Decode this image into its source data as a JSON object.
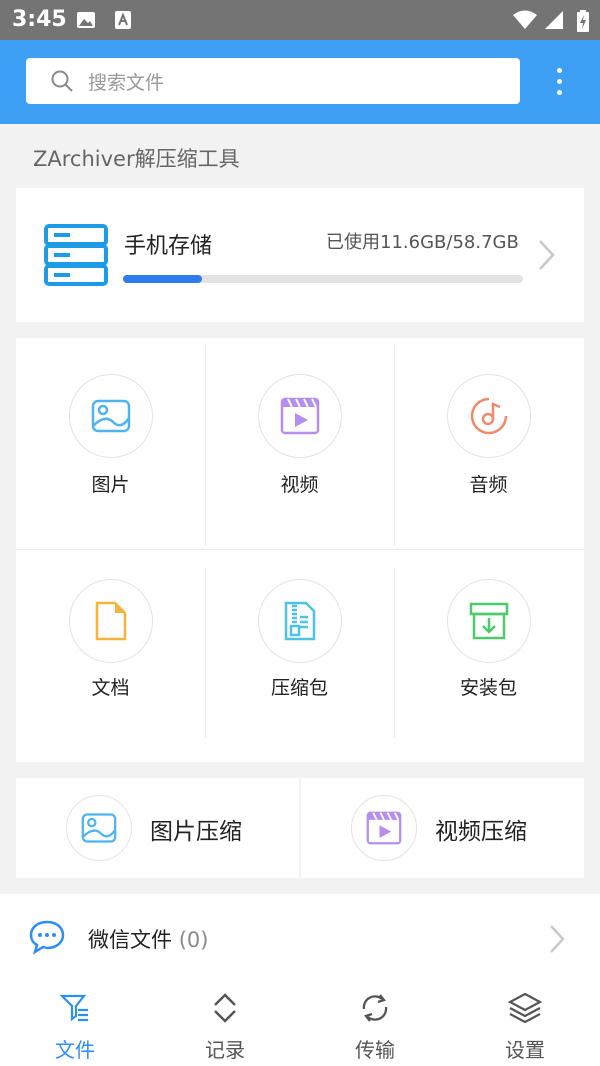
{
  "status_bar": {
    "time": "3:45"
  },
  "search": {
    "placeholder": "搜索文件"
  },
  "section_title": "ZArchiver解压缩工具",
  "storage": {
    "label": "手机存储",
    "used_text": "已使用11.6GB/58.7GB",
    "used_fraction": 0.198
  },
  "categories": [
    {
      "label": "图片",
      "icon": "image-icon"
    },
    {
      "label": "视频",
      "icon": "video-icon"
    },
    {
      "label": "音频",
      "icon": "audio-icon"
    },
    {
      "label": "文档",
      "icon": "document-icon"
    },
    {
      "label": "压缩包",
      "icon": "archive-icon"
    },
    {
      "label": "安装包",
      "icon": "install-package-icon"
    }
  ],
  "compress_tools": [
    {
      "label": "图片压缩",
      "icon": "image-icon"
    },
    {
      "label": "视频压缩",
      "icon": "video-icon"
    }
  ],
  "wechat": {
    "label": "微信文件",
    "count": "(0)"
  },
  "bottom_nav": [
    {
      "label": "文件",
      "icon": "filter-list-icon",
      "active": true
    },
    {
      "label": "记录",
      "icon": "chevron-updown-icon",
      "active": false
    },
    {
      "label": "传输",
      "icon": "sync-icon",
      "active": false
    },
    {
      "label": "设置",
      "icon": "layers-icon",
      "active": false
    }
  ],
  "colors": {
    "app_bar": "#3da0f5",
    "status_bar": "#747474",
    "accent": "#2e8ef5",
    "progress_fill": "#2e7cf0",
    "image_icon": "#4fb3f0",
    "video_icon": "#b58ef0",
    "audio_icon": "#f08a6a",
    "document_icon": "#f6b33e",
    "archive_icon": "#4cc3e6",
    "install_icon": "#4ec96c"
  }
}
